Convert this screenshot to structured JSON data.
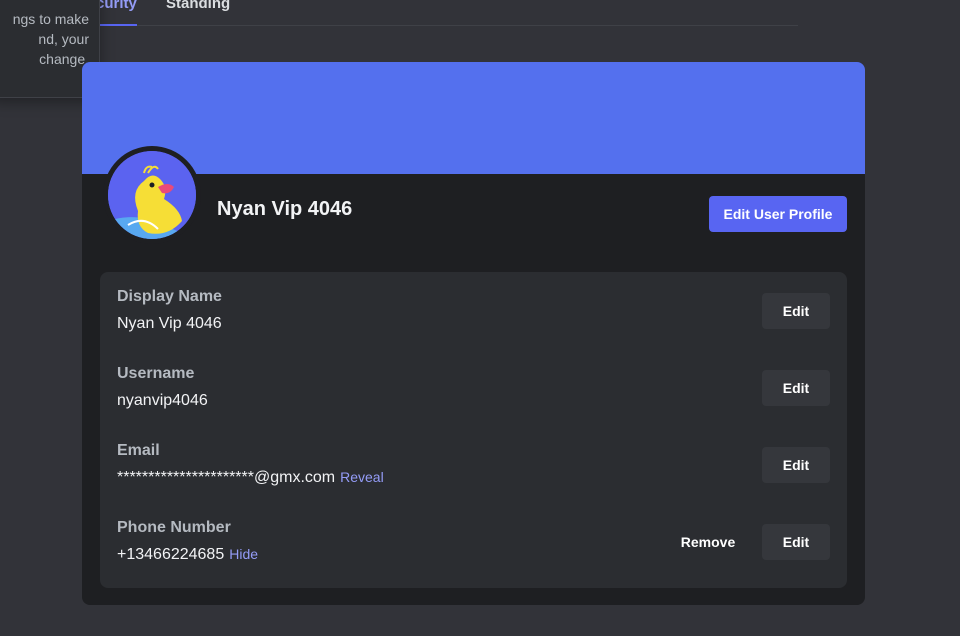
{
  "tabs": [
    {
      "label": "curity",
      "active": true
    },
    {
      "label": "Standing",
      "active": false
    }
  ],
  "tooltip": {
    "lines": [
      "ngs to make",
      "nd, your",
      "change."
    ]
  },
  "profile": {
    "display_name": "Nyan Vip 4046",
    "edit_profile_label": "Edit User Profile",
    "banner_color": "#5470ee",
    "accent_color": "#5865f2"
  },
  "fields": [
    {
      "label": "Display Name",
      "value": "Nyan Vip 4046",
      "edit_label": "Edit"
    },
    {
      "label": "Username",
      "value": "nyanvip4046",
      "edit_label": "Edit"
    },
    {
      "label": "Email",
      "value": "**********************@gmx.com",
      "link": "Reveal",
      "edit_label": "Edit"
    },
    {
      "label": "Phone Number",
      "value": "+13466224685",
      "link": "Hide",
      "remove_label": "Remove",
      "edit_label": "Edit"
    }
  ]
}
